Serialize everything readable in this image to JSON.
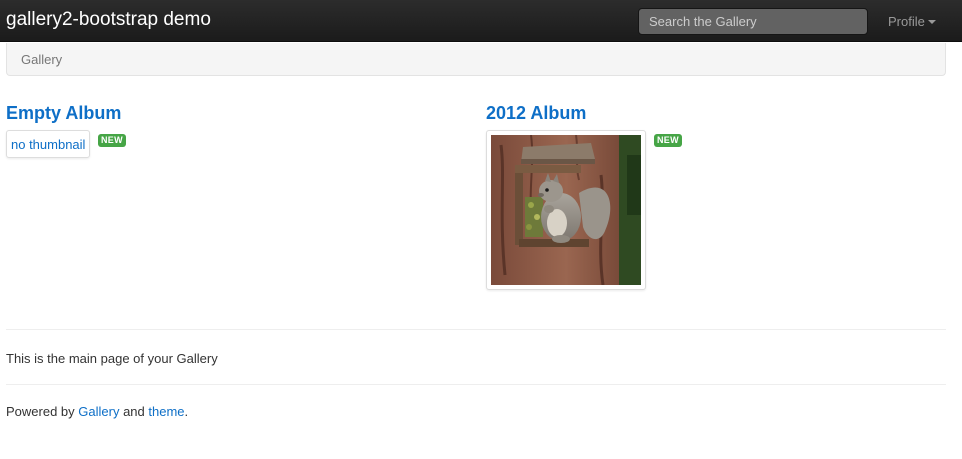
{
  "navbar": {
    "brand": "gallery2-bootstrap demo",
    "search_placeholder": "Search the Gallery",
    "profile_label": "Profile",
    "profile_icon": "caret-down-icon"
  },
  "breadcrumb": {
    "items": [
      "Gallery"
    ]
  },
  "albums": [
    {
      "title": "Empty Album",
      "thumbnail_text": "no thumbnail",
      "badge": "NEW"
    },
    {
      "title": "2012 Album",
      "thumbnail_alt": "squirrel on a feeder",
      "badge": "NEW"
    }
  ],
  "main_description": "This is the main page of your Gallery",
  "footer": {
    "prefix": "Powered by ",
    "gallery_link": "Gallery",
    "middle": " and ",
    "theme_link": "theme",
    "suffix": "."
  },
  "colors": {
    "navbar_bg": "#1b1b1b",
    "link": "#0e6fc7",
    "badge_new": "#46a546"
  }
}
